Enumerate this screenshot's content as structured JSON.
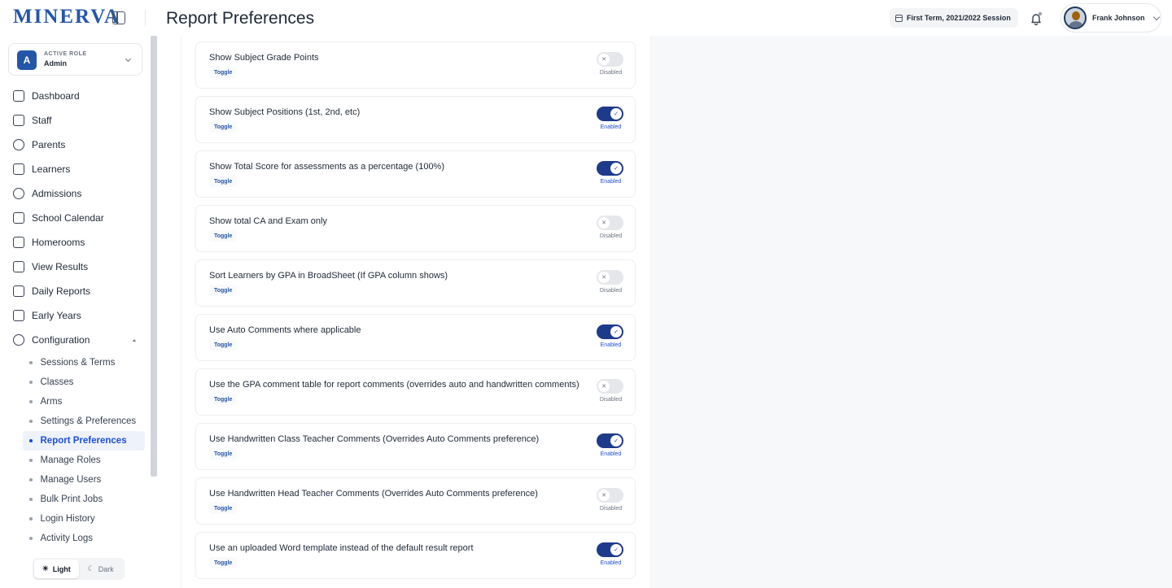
{
  "app": {
    "logo": "MINERVA"
  },
  "header": {
    "title": "Report Preferences",
    "session": "First Term, 2021/2022 Session",
    "user_name": "Frank Johnson"
  },
  "role": {
    "label": "ACTIVE ROLE",
    "value": "Admin",
    "initial": "A"
  },
  "nav": [
    {
      "label": "Dashboard",
      "icon": "dashboard-icon"
    },
    {
      "label": "Staff",
      "icon": "staff-icon"
    },
    {
      "label": "Parents",
      "icon": "parents-icon"
    },
    {
      "label": "Learners",
      "icon": "learners-icon"
    },
    {
      "label": "Admissions",
      "icon": "admissions-icon"
    },
    {
      "label": "School Calendar",
      "icon": "calendar-icon"
    },
    {
      "label": "Homerooms",
      "icon": "homerooms-icon"
    },
    {
      "label": "View Results",
      "icon": "results-icon"
    },
    {
      "label": "Daily Reports",
      "icon": "reports-icon"
    },
    {
      "label": "Early Years",
      "icon": "early-years-icon"
    },
    {
      "label": "Configuration",
      "icon": "gear-icon"
    }
  ],
  "config_sub": [
    "Sessions & Terms",
    "Classes",
    "Arms",
    "Settings & Preferences",
    "Report Preferences",
    "Manage Roles",
    "Manage Users",
    "Bulk Print Jobs",
    "Login History",
    "Activity Logs"
  ],
  "theme": {
    "light": "Light",
    "dark": "Dark"
  },
  "preferences": [
    {
      "title": "Show Subject Grade Points",
      "badge": "Toggle",
      "enabled": false,
      "state": "Disabled"
    },
    {
      "title": "Show Subject Positions (1st, 2nd, etc)",
      "badge": "Toggle",
      "enabled": true,
      "state": "Enabled"
    },
    {
      "title": "Show Total Score for assessments as a percentage (100%)",
      "badge": "Toggle",
      "enabled": true,
      "state": "Enabled"
    },
    {
      "title": "Show total CA and Exam only",
      "badge": "Toggle",
      "enabled": false,
      "state": "Disabled"
    },
    {
      "title": "Sort Learners by GPA in BroadSheet (If GPA column shows)",
      "badge": "Toggle",
      "enabled": false,
      "state": "Disabled"
    },
    {
      "title": "Use Auto Comments where applicable",
      "badge": "Toggle",
      "enabled": true,
      "state": "Enabled"
    },
    {
      "title": "Use the GPA comment table for report comments (overrides auto and handwritten comments)",
      "badge": "Toggle",
      "enabled": false,
      "state": "Disabled"
    },
    {
      "title": "Use Handwritten Class Teacher Comments (Overrides Auto Comments preference)",
      "badge": "Toggle",
      "enabled": true,
      "state": "Enabled"
    },
    {
      "title": "Use Handwritten Head Teacher Comments (Overrides Auto Comments preference)",
      "badge": "Toggle",
      "enabled": false,
      "state": "Disabled"
    },
    {
      "title": "Use an uploaded Word template instead of the default result report",
      "badge": "Toggle",
      "enabled": true,
      "state": "Enabled"
    }
  ],
  "colors": {
    "brand": "#2456a8",
    "toggle_on": "#1e3a8a",
    "toggle_off": "#e5e7eb"
  }
}
